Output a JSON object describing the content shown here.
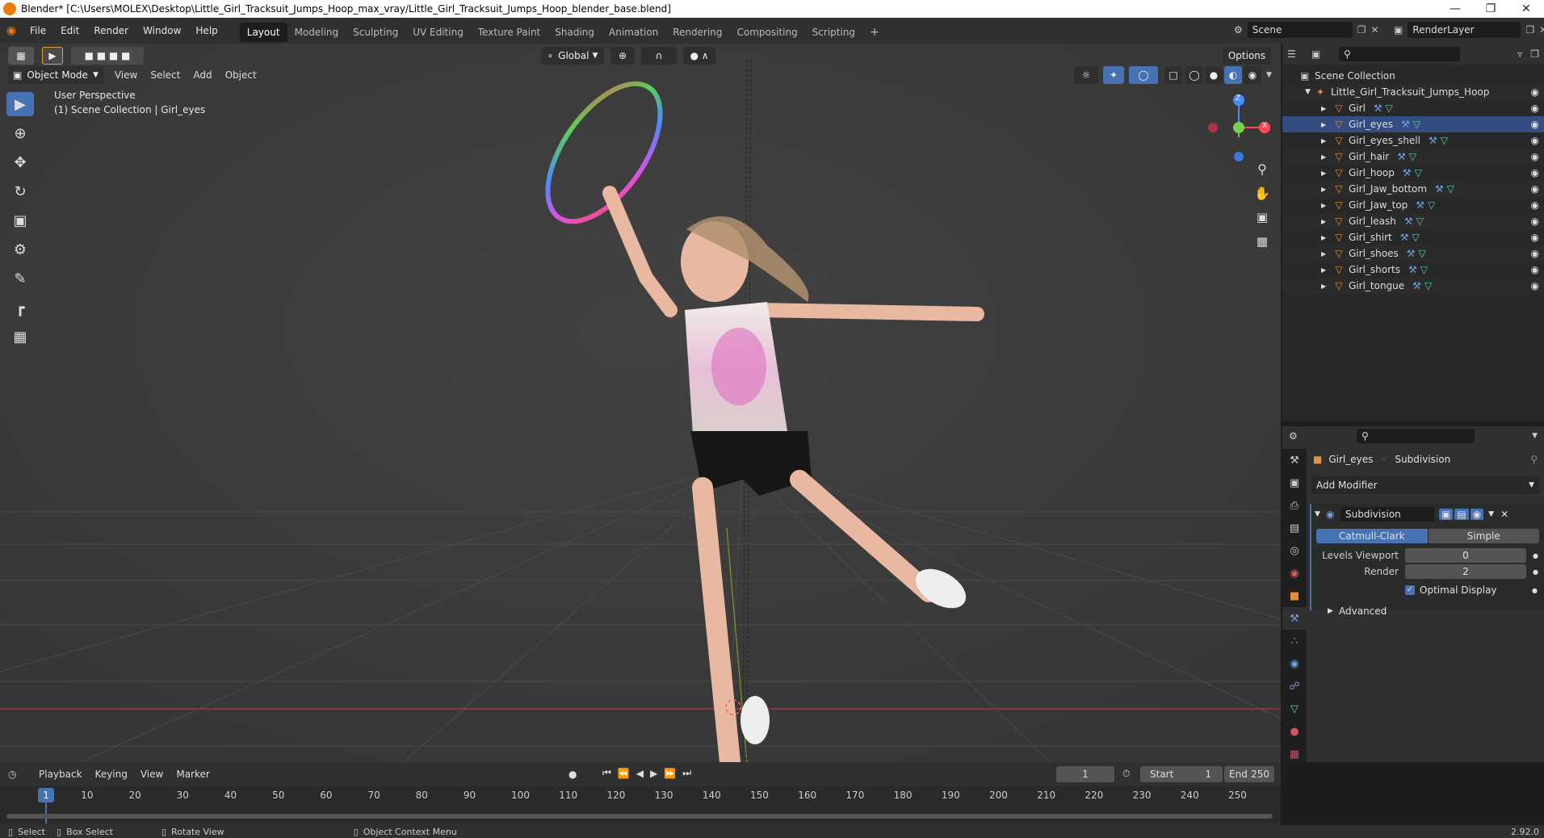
{
  "window": {
    "title": "Blender* [C:\\Users\\MOLEX\\Desktop\\Little_Girl_Tracksuit_Jumps_Hoop_max_vray/Little_Girl_Tracksuit_Jumps_Hoop_blender_base.blend]"
  },
  "menu": {
    "items": [
      "File",
      "Edit",
      "Render",
      "Window",
      "Help"
    ]
  },
  "workspaces": {
    "tabs": [
      "Layout",
      "Modeling",
      "Sculpting",
      "UV Editing",
      "Texture Paint",
      "Shading",
      "Animation",
      "Rendering",
      "Compositing",
      "Scripting"
    ],
    "active": "Layout"
  },
  "topbar": {
    "scene": "Scene",
    "render_layer": "RenderLayer"
  },
  "viewport": {
    "transform_orientation": "Global",
    "options_label": "Options",
    "mode": "Object Mode",
    "menus": [
      "View",
      "Select",
      "Add",
      "Object"
    ],
    "overlay_title": "User Perspective",
    "overlay_subtitle": "(1) Scene Collection | Girl_eyes",
    "gizmo_z": "Z",
    "gizmo_x": "X"
  },
  "outliner": {
    "root": "Scene Collection",
    "collection": "Little_Girl_Tracksuit_Jumps_Hoop",
    "objects": [
      "Girl",
      "Girl_eyes",
      "Girl_eyes_shell",
      "Girl_hair",
      "Girl_hoop",
      "Girl_Jaw_bottom",
      "Girl_Jaw_top",
      "Girl_leash",
      "Girl_shirt",
      "Girl_shoes",
      "Girl_shorts",
      "Girl_tongue"
    ]
  },
  "properties": {
    "object_name": "Girl_eyes",
    "modifier_crumb": "Subdivision",
    "add_modifier": "Add Modifier",
    "modifier_name": "Subdivision",
    "method_a": "Catmull-Clark",
    "method_b": "Simple",
    "levels_label": "Levels Viewport",
    "levels_value": "0",
    "render_label": "Render",
    "render_value": "2",
    "optimal_label": "Optimal Display",
    "advanced_label": "Advanced"
  },
  "timeline": {
    "menus": [
      "Playback",
      "Keying",
      "View",
      "Marker"
    ],
    "current_frame": "1",
    "start_label": "Start",
    "start_value": "1",
    "end_label": "End",
    "end_value": "250",
    "cursor_label": "1",
    "ticks": [
      "10",
      "20",
      "30",
      "40",
      "50",
      "60",
      "70",
      "80",
      "90",
      "100",
      "110",
      "120",
      "130",
      "140",
      "150",
      "160",
      "170",
      "180",
      "190",
      "200",
      "210",
      "220",
      "230",
      "240",
      "250"
    ]
  },
  "statusbar": {
    "select": "Select",
    "box_select": "Box Select",
    "rotate_view": "Rotate View",
    "context_menu": "Object Context Menu",
    "version": "2.92.0"
  },
  "colors": {
    "accent": "#4772b3",
    "mesh": "#e88e3c",
    "viewport_bg": "#3d3d3d"
  }
}
